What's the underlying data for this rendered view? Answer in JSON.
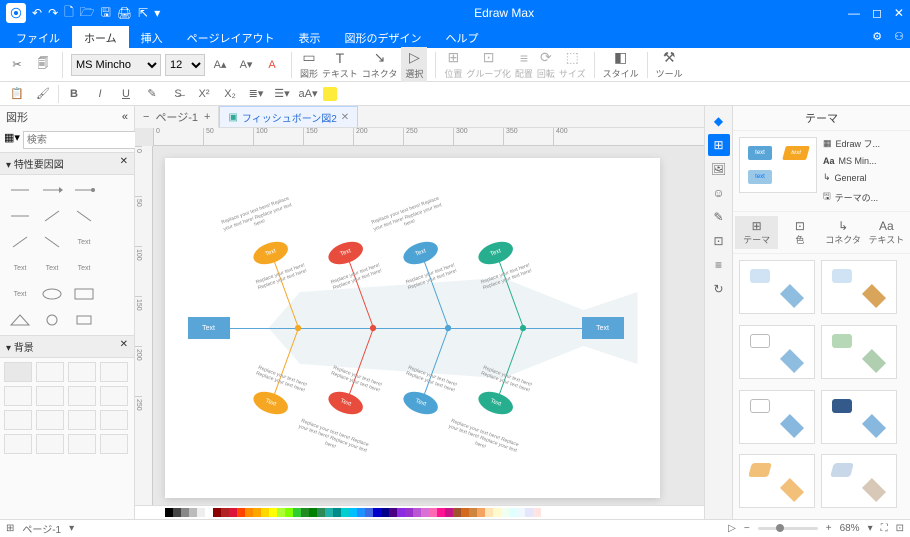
{
  "app": {
    "title": "Edraw Max"
  },
  "qat": {
    "undo": "↶",
    "redo": "↷"
  },
  "menu": {
    "items": [
      "ファイル",
      "ホーム",
      "挿入",
      "ページレイアウト",
      "表示",
      "図形のデザイン",
      "ヘルプ"
    ],
    "active_index": 1
  },
  "ribbon": {
    "font_name": "MS Mincho",
    "font_size": "12",
    "groups": {
      "shape": "図形",
      "text": "テキスト",
      "connector": "コネクタ",
      "select": "選択",
      "pos": "位置",
      "group": "グループ化",
      "align": "配置",
      "rotate": "回転",
      "size": "サイズ",
      "style": "スタイル",
      "tool": "ツール"
    }
  },
  "left": {
    "title": "図形",
    "search_placeholder": "検索",
    "accordion1": "特性要因図",
    "accordion2": "背景",
    "shape_label": "Text"
  },
  "doc": {
    "tab_name": "フィッシュボーン図2",
    "page_label": "ページ-1",
    "head": "Text",
    "tail": "Text",
    "oval_label": "Text",
    "bone_text": "Replace your text here! Replace your text here!",
    "end_text": "Replace your text here! Replace your text here! Replace your text here!",
    "ruler_marks": [
      "0",
      "50",
      "100",
      "150",
      "200",
      "250",
      "300",
      "350",
      "400"
    ]
  },
  "right": {
    "title": "テーマ",
    "preview_nodes": [
      "text",
      "text",
      "text"
    ],
    "list": [
      "Edraw フ...",
      "MS Min...",
      "General",
      "テーマの..."
    ],
    "tabs": [
      "テーマ",
      "色",
      "コネクタ",
      "テキスト"
    ]
  },
  "status": {
    "zoom": "68%"
  },
  "colors": [
    "#000",
    "#444",
    "#888",
    "#bbb",
    "#eee",
    "#fff",
    "#8b0000",
    "#b22222",
    "#dc143c",
    "#ff4500",
    "#ff8c00",
    "#ffa500",
    "#ffd700",
    "#ffff00",
    "#adff2f",
    "#7fff00",
    "#32cd32",
    "#228b22",
    "#008000",
    "#2e8b57",
    "#20b2aa",
    "#008b8b",
    "#00ced1",
    "#00bfff",
    "#1e90ff",
    "#4169e1",
    "#0000cd",
    "#00008b",
    "#4b0082",
    "#8a2be2",
    "#9932cc",
    "#ba55d3",
    "#da70d6",
    "#ff69b4",
    "#ff1493",
    "#c71585",
    "#a0522d",
    "#d2691e",
    "#cd853f",
    "#f4a460",
    "#ffe4b5",
    "#fffacd",
    "#f0fff0",
    "#e0ffff",
    "#f0f8ff",
    "#e6e6fa",
    "#ffe4e1"
  ],
  "chart_data": {
    "type": "fishbone",
    "head": "Text",
    "tail": "Text",
    "causes_top": [
      {
        "label": "Text",
        "color": "#f5a623",
        "notes": "Replace your text here!"
      },
      {
        "label": "Text",
        "color": "#e74c3c",
        "notes": "Replace your text here!"
      },
      {
        "label": "Text",
        "color": "#4da3d4",
        "notes": "Replace your text here!"
      },
      {
        "label": "Text",
        "color": "#27ae8e",
        "notes": "Replace your text here!"
      }
    ],
    "causes_bottom": [
      {
        "label": "Text",
        "color": "#f5a623",
        "notes": "Replace your text here!"
      },
      {
        "label": "Text",
        "color": "#e74c3c",
        "notes": "Replace your text here!"
      },
      {
        "label": "Text",
        "color": "#4da3d4",
        "notes": "Replace your text here!"
      },
      {
        "label": "Text",
        "color": "#27ae8e",
        "notes": "Replace your text here!"
      }
    ]
  }
}
